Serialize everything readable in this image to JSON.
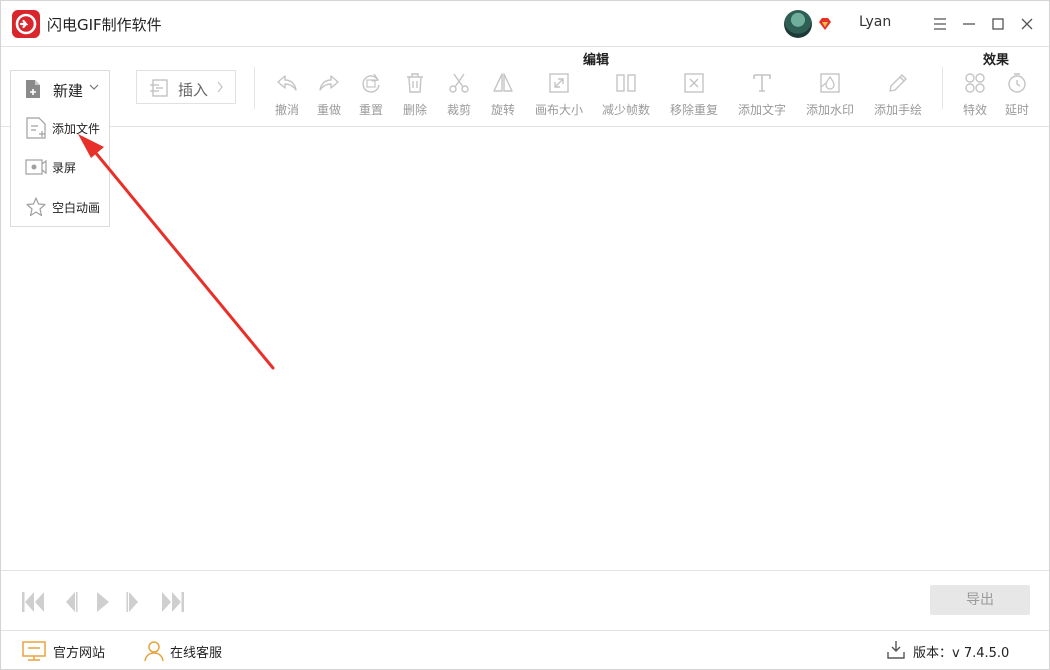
{
  "app": {
    "title": "闪电GIF制作软件",
    "username": "Lyan",
    "brand_color": "#d9252c"
  },
  "toolbar": {
    "new_label": "新建",
    "insert_label": "插入",
    "group_edit": "编辑",
    "group_effect": "效果",
    "tools": [
      {
        "label": "撤消",
        "icon": "undo-icon"
      },
      {
        "label": "重做",
        "icon": "redo-icon"
      },
      {
        "label": "重置",
        "icon": "reset-icon"
      },
      {
        "label": "删除",
        "icon": "delete-icon"
      },
      {
        "label": "裁剪",
        "icon": "scissors-icon"
      },
      {
        "label": "旋转",
        "icon": "rotate-icon"
      },
      {
        "label": "画布大小",
        "icon": "canvas-size-icon"
      },
      {
        "label": "减少帧数",
        "icon": "reduce-frames-icon"
      },
      {
        "label": "移除重复",
        "icon": "remove-duplicates-icon"
      },
      {
        "label": "添加文字",
        "icon": "add-text-icon"
      },
      {
        "label": "添加水印",
        "icon": "add-watermark-icon"
      },
      {
        "label": "添加手绘",
        "icon": "add-drawing-icon"
      },
      {
        "label": "特效",
        "icon": "effects-icon"
      },
      {
        "label": "延时",
        "icon": "delay-icon"
      }
    ]
  },
  "new_menu": {
    "items": [
      {
        "label": "添加文件",
        "icon": "add-file-icon"
      },
      {
        "label": "录屏",
        "icon": "screen-record-icon"
      },
      {
        "label": "空白动画",
        "icon": "blank-animation-icon"
      }
    ]
  },
  "playback": {
    "export_label": "导出"
  },
  "status": {
    "website_label": "官方网站",
    "support_label": "在线客服",
    "version_label": "版本：",
    "version_value": "v 7.4.5.0",
    "accent_color": "#e8a33d"
  },
  "annotation": {
    "arrow_color": "#e8302a"
  }
}
